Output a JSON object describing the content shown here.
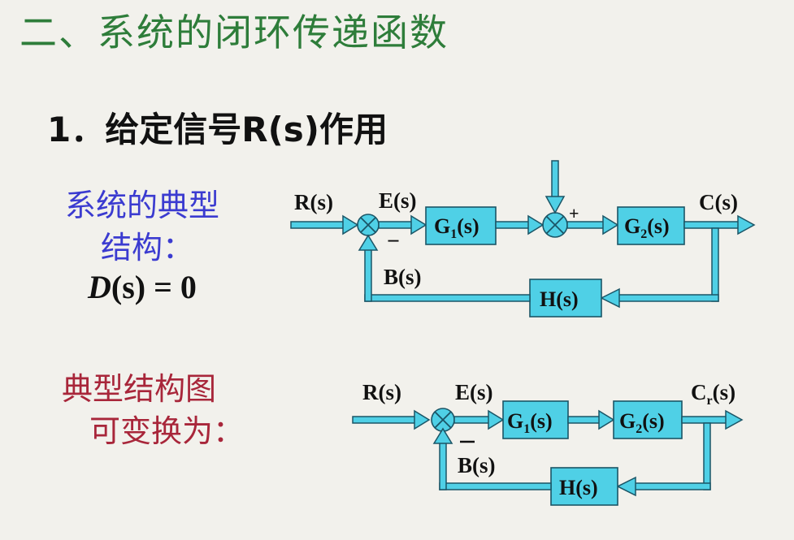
{
  "title": "二、系统的闭环传递函数",
  "subtitle": "1．给定信号R(s)作用",
  "left_top": {
    "line1": "系统的典型",
    "line2": "结构：",
    "eq_D": "D",
    "eq_rest": "(s) = 0"
  },
  "left_bottom": {
    "line1": "典型结构图",
    "line2": "可变换为："
  },
  "diagram1": {
    "input": "R(s)",
    "error": "E(s)",
    "feedback": "B(s)",
    "output": "C(s)",
    "g1": "G",
    "g1_sub": "1",
    "g1_tail": "(s)",
    "g2": "G",
    "g2_sub": "2",
    "g2_tail": "(s)",
    "h": "H(s)",
    "minus": "−",
    "plus": "+"
  },
  "diagram2": {
    "input": "R(s)",
    "error": "E(s)",
    "feedback": "B(s)",
    "output_main": "C",
    "output_sub": "r",
    "output_tail": "(s)",
    "g1": "G",
    "g1_sub": "1",
    "g1_tail": "(s)",
    "g2": "G",
    "g2_sub": "2",
    "g2_tail": "(s)",
    "h": "H(s)"
  },
  "colors": {
    "title": "#2e7d3a",
    "block_fill": "#4fd0e6",
    "block_stroke": "#1b5566",
    "blue_text": "#3b3bd0",
    "red_text": "#a8263a"
  }
}
